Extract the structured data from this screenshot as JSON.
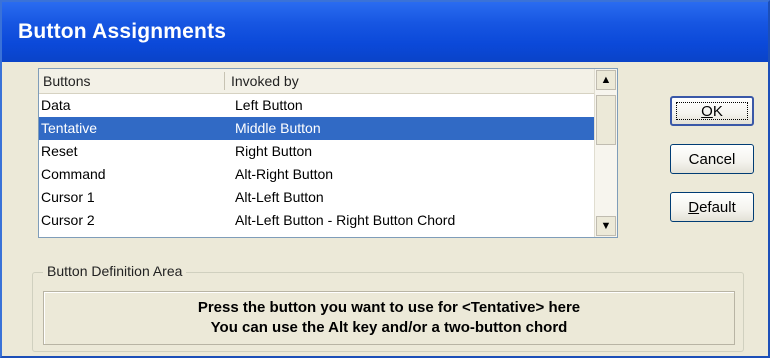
{
  "dialog": {
    "title": "Button Assignments"
  },
  "list": {
    "headers": [
      "Buttons",
      "Invoked by"
    ],
    "rows": [
      {
        "button": "Data",
        "invoked_by": "Left Button"
      },
      {
        "button": "Tentative",
        "invoked_by": "Middle Button",
        "selected": true
      },
      {
        "button": "Reset",
        "invoked_by": "Right Button"
      },
      {
        "button": "Command",
        "invoked_by": "Alt-Right Button"
      },
      {
        "button": "Cursor 1",
        "invoked_by": "Alt-Left Button"
      },
      {
        "button": "Cursor 2",
        "invoked_by": "Alt-Left Button - Right Button Chord"
      }
    ]
  },
  "buttons": {
    "ok": {
      "mnemonic": "O",
      "rest": "K"
    },
    "cancel": "Cancel",
    "default": {
      "mnemonic": "D",
      "rest": "efault"
    }
  },
  "definition_area": {
    "legend": "Button Definition Area",
    "line1": "Press the button you want to use for <Tentative> here",
    "line2": "You can use the Alt key and/or a two-button chord"
  },
  "colors": {
    "titlebar": "#0b49d9",
    "selection": "#316ac5",
    "dialog_bg": "#ece9d8"
  },
  "icons": {
    "scroll_up": "triangle-up-icon",
    "scroll_down": "triangle-down-icon"
  }
}
